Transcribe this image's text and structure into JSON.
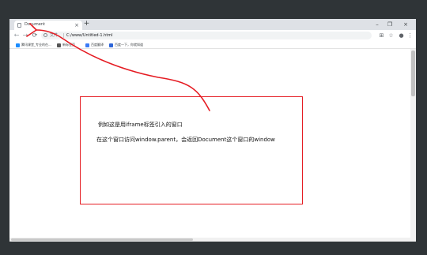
{
  "browser": {
    "tab_title": "Document",
    "tab_close": "×",
    "new_tab": "+",
    "window_controls": {
      "minimize": "–",
      "restore": "❐",
      "close": "×"
    },
    "nav": {
      "back": "←",
      "forward": "→",
      "reload": "⟳"
    },
    "address": {
      "security_label": "文件",
      "url": "C:/www/Untitled-1.html"
    },
    "toolbar_icons": {
      "translate": "⊞",
      "star": "☆",
      "profile": "●",
      "menu": "⋮"
    },
    "bookmarks": [
      {
        "label": "腾讯课堂_专业的在...",
        "color": "#1a8cff"
      },
      {
        "label": "新标签页",
        "color": "#555555"
      },
      {
        "label": "百度翻译",
        "color": "#3b7bf6"
      },
      {
        "label": "百度一下，你就知道",
        "color": "#2d65d8"
      }
    ]
  },
  "page": {
    "iframe_note": "例如这是用iframe标签引入的窗口",
    "parent_note": "在这个窗口访问window.parent，会返回Document这个窗口的window"
  },
  "colors": {
    "annotation": "#e51c23",
    "backdrop": "#2f3437"
  }
}
